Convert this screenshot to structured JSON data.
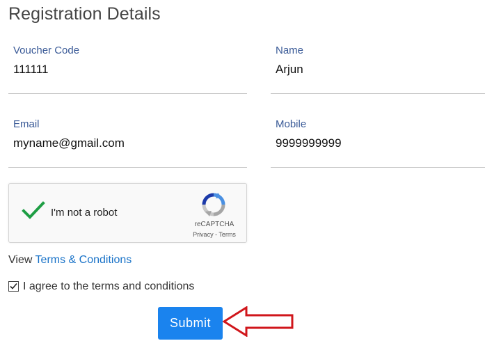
{
  "page_title": "Registration Details",
  "fields": {
    "voucher": {
      "label": "Voucher Code",
      "value": "111111"
    },
    "name": {
      "label": "Name",
      "value": "Arjun"
    },
    "email": {
      "label": "Email",
      "value": "myname@gmail.com"
    },
    "mobile": {
      "label": "Mobile",
      "value": "9999999999"
    }
  },
  "captcha": {
    "label": "I'm not a robot",
    "brand": "reCAPTCHA",
    "privacy": "Privacy",
    "separator": " - ",
    "terms": "Terms",
    "checked": true
  },
  "terms_line": {
    "prefix": "View ",
    "link": "Terms & Conditions"
  },
  "agree": {
    "label": "I agree to the terms and conditions",
    "checked": true
  },
  "submit_label": "Submit",
  "colors": {
    "label": "#3a5a97",
    "link": "#1a73c8",
    "submit": "#1a83ee",
    "arrow": "#d0161b",
    "check": "#1e9e44"
  }
}
